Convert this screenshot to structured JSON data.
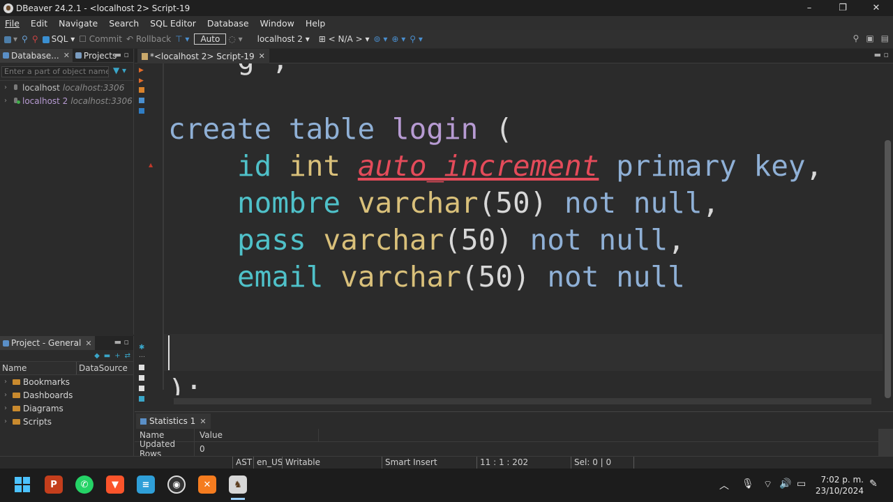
{
  "window": {
    "title": "DBeaver 24.2.1 - <localhost 2> Script-19",
    "controls": [
      "minimize-icon",
      "maximize-icon",
      "close-icon"
    ]
  },
  "menu": [
    "File",
    "Edit",
    "Navigate",
    "Search",
    "SQL Editor",
    "Database",
    "Window",
    "Help"
  ],
  "toolbar": {
    "sql": "SQL",
    "commit": "Commit",
    "rollback": "Rollback",
    "auto": "Auto",
    "connection": "localhost 2",
    "schema": "< N/A >"
  },
  "navigator": {
    "tab_label": "Database...",
    "projects_tab": "Projects",
    "filter_placeholder": "Enter a part of object name h",
    "connections": [
      {
        "name": "localhost",
        "host": "localhost:3306"
      },
      {
        "name": "localhost 2",
        "host": "localhost:3306"
      }
    ]
  },
  "project": {
    "tab_label": "Project - General",
    "columns": [
      "Name",
      "DataSource"
    ],
    "items": [
      "Bookmarks",
      "Dashboards",
      "Diagrams",
      "Scripts"
    ]
  },
  "editor": {
    "tab_label": "*<localhost 2> Script-19",
    "code": {
      "l1_kw1": "create",
      "l1_kw2": "table",
      "l1_name": "login",
      "l1_paren": "(",
      "l2_col": "id",
      "l2_type": "int",
      "l2_err": "auto_increment",
      "l2_kw": "primary key",
      "l2_punc": ",",
      "l3_col": "nombre",
      "l3_type": "varchar",
      "l3_args": "(50)",
      "l3_kw": "not null",
      "l3_punc": ",",
      "l4_col": "pass",
      "l4_type": "varchar",
      "l4_args": "(50)",
      "l4_kw": "not null",
      "l4_punc": ",",
      "l5_col": "email",
      "l5_type": "varchar",
      "l5_args": "(50)",
      "l5_kw": "not null",
      "l7_end": ");"
    }
  },
  "results": {
    "tab_label": "Statistics 1",
    "columns": [
      "Name",
      "Value"
    ],
    "rows": [
      [
        "Updated Rows",
        "0"
      ]
    ]
  },
  "status": {
    "tz": "AST",
    "locale": "en_US",
    "mode": "Writable",
    "insert": "Smart Insert",
    "position": "11 : 1 : 202",
    "selection": "Sel: 0 | 0"
  },
  "taskbar": {
    "time": "7:02 p. m.",
    "date": "23/10/2024",
    "apps": [
      "windows-start",
      "powerpoint",
      "whatsapp",
      "brave",
      "notepad",
      "obs",
      "xampp",
      "dbeaver"
    ]
  },
  "colors": {
    "keyword": "#8fb0d6",
    "table_name": "#b79bd3",
    "column": "#4fc1c9",
    "type": "#d9c07a",
    "error": "#e44b5a"
  }
}
